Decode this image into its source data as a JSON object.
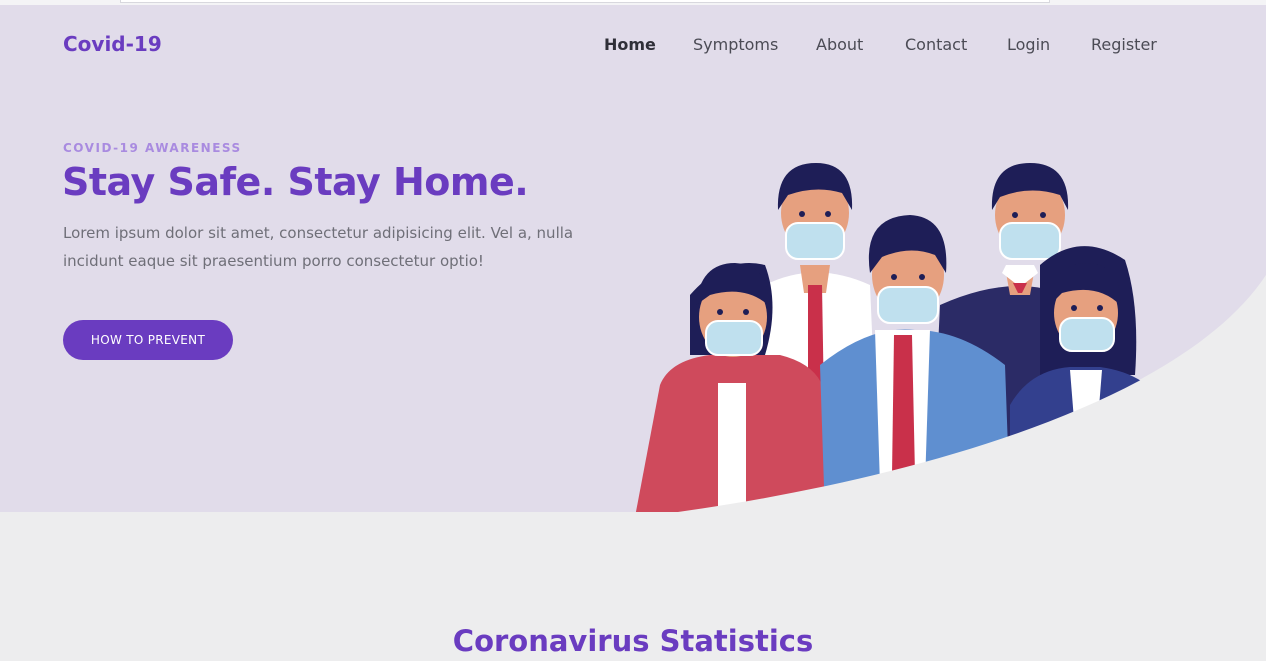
{
  "brand": "Covid-19",
  "nav": {
    "items": [
      {
        "label": "Home",
        "active": true
      },
      {
        "label": "Symptoms",
        "active": false
      },
      {
        "label": "About",
        "active": false
      },
      {
        "label": "Contact",
        "active": false
      },
      {
        "label": "Login",
        "active": false
      },
      {
        "label": "Register",
        "active": false
      }
    ]
  },
  "hero": {
    "eyebrow": "COVID-19 AWARENESS",
    "title": "Stay Safe. Stay Home.",
    "body": "Lorem ipsum dolor sit amet, consectetur adipisicing elit. Vel a, nulla incidunt eaque sit praesentium porro consectetur optio!",
    "cta_label": "HOW TO PREVENT",
    "illustration": "people-wearing-masks-illustration"
  },
  "statistics": {
    "title": "Coronavirus Statistics"
  },
  "colors": {
    "accent": "#6a3cc0",
    "hero_bg": "#e1dcea",
    "page_bg": "#ededee"
  }
}
